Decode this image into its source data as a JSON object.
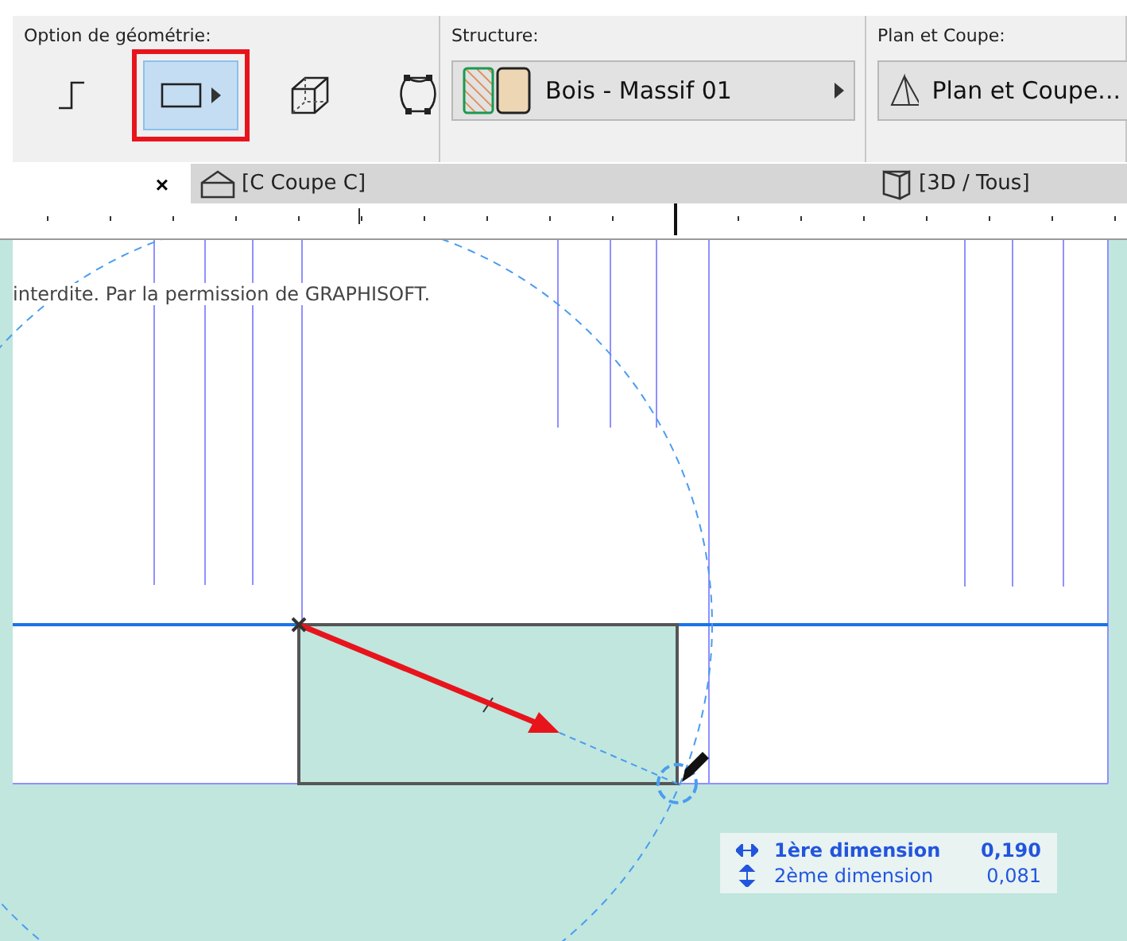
{
  "toolbar": {
    "sections": [
      {
        "kind": "geometry",
        "label": "Option de géométrie:",
        "options": [
          {
            "selected": false,
            "highlighted": false
          },
          {
            "selected": true,
            "highlighted": true
          },
          {
            "selected": false,
            "highlighted": false
          },
          {
            "selected": false,
            "highlighted": false
          }
        ]
      },
      {
        "kind": "structure",
        "label": "Structure:",
        "value": "Bois - Massif 01"
      },
      {
        "kind": "plan",
        "label": "Plan et Coupe:",
        "value": "Plan et Coupe..."
      }
    ]
  },
  "tabs": [
    {
      "close": "×",
      "selected": true
    },
    {
      "label": "[C Coupe C]",
      "selected": false
    },
    {
      "label": "[3D / Tous]",
      "selected": false
    }
  ],
  "canvas": {
    "note": "interdite. Par la permission de GRAPHISOFT."
  },
  "tooltip": {
    "rows": [
      {
        "label": "1ère dimension",
        "value": "0,190",
        "bold": true
      },
      {
        "label": "2ème dimension",
        "value": "0,081",
        "bold": false
      }
    ]
  }
}
